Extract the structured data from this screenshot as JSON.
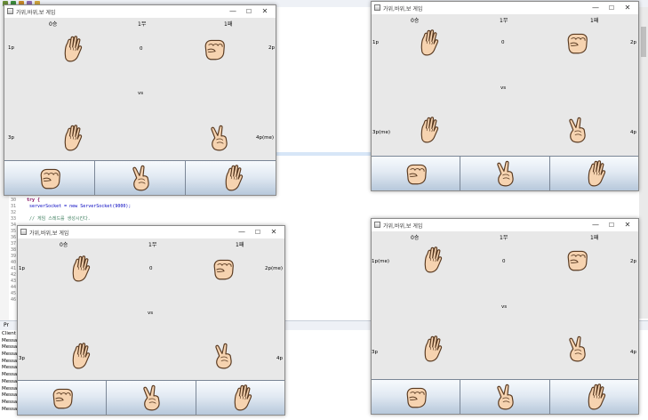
{
  "ide": {
    "code": [
      {
        "ln": "30",
        "text": "try {",
        "cls": "kw"
      },
      {
        "ln": "31",
        "text": "    serverSocket = new ServerSocket(9000);",
        "cls": "vr"
      },
      {
        "ln": "32",
        "text": "",
        "cls": ""
      },
      {
        "ln": "33",
        "text": "    // 게임 스레드를 생성시킨다.",
        "cls": "cm"
      }
    ],
    "line_numbers": [
      "34",
      "35",
      "36",
      "37",
      "38",
      "39",
      "40",
      "41",
      "42",
      "43",
      "44",
      "45",
      "46"
    ],
    "console_tab": "Pr",
    "console_lines": [
      "Client",
      "Messa",
      "Messa",
      "Messa",
      "Messa",
      "Messa",
      "Messa",
      "Messa",
      "Messa",
      "Messa",
      "Messa",
      "Messa"
    ]
  },
  "icons": {
    "rock": "rock-hand-icon",
    "scissors": "scissors-hand-icon",
    "paper": "paper-hand-icon"
  },
  "colors": {
    "skin": "#f6d3b0",
    "skin_outline": "#5a3b22",
    "button_top": "#f7fafd",
    "button_bottom": "#b7c8db"
  },
  "windows": [
    {
      "title": "가위,바위,보 게임",
      "controls": {
        "minimize": "—",
        "maximize": "☐",
        "close": "✕"
      },
      "stats": {
        "win": "0승",
        "draw": "1무",
        "lose": "1패"
      },
      "labels": {
        "tl": "1p",
        "tr": "2p",
        "bl": "3p",
        "br": "4p(me)"
      },
      "hands": {
        "tl": "paper",
        "tr": "rock",
        "bl": "paper",
        "br": "scissors"
      },
      "center_top": "0",
      "center_vs": "vs",
      "buttons": [
        "rock",
        "scissors",
        "paper"
      ]
    },
    {
      "title": "가위,바위,보 게임",
      "controls": {
        "minimize": "—",
        "maximize": "☐",
        "close": "✕"
      },
      "stats": {
        "win": "0승",
        "draw": "1무",
        "lose": "1패"
      },
      "labels": {
        "tl": "1p",
        "tr": "2p",
        "bl": "3p(me)",
        "br": "4p"
      },
      "hands": {
        "tl": "paper",
        "tr": "rock",
        "bl": "paper",
        "br": "scissors"
      },
      "center_top": "0",
      "center_vs": "vs",
      "buttons": [
        "rock",
        "scissors",
        "paper"
      ]
    },
    {
      "title": "가위,바위,보 게임",
      "controls": {
        "minimize": "—",
        "maximize": "☐",
        "close": "✕"
      },
      "stats": {
        "win": "0승",
        "draw": "1무",
        "lose": "1패"
      },
      "labels": {
        "tl": "1p",
        "tr": "2p(me)",
        "bl": "3p",
        "br": "4p"
      },
      "hands": {
        "tl": "paper",
        "tr": "rock",
        "bl": "paper",
        "br": "scissors"
      },
      "center_top": "0",
      "center_vs": "vs",
      "buttons": [
        "rock",
        "scissors",
        "paper"
      ]
    },
    {
      "title": "가위,바위,보 게임",
      "controls": {
        "minimize": "—",
        "maximize": "☐",
        "close": "✕"
      },
      "stats": {
        "win": "0승",
        "draw": "1무",
        "lose": "1패"
      },
      "labels": {
        "tl": "1p(me)",
        "tr": "2p",
        "bl": "3p",
        "br": "4p"
      },
      "hands": {
        "tl": "paper",
        "tr": "rock",
        "bl": "paper",
        "br": "scissors"
      },
      "center_top": "0",
      "center_vs": "vs",
      "buttons": [
        "rock",
        "scissors",
        "paper"
      ]
    }
  ]
}
